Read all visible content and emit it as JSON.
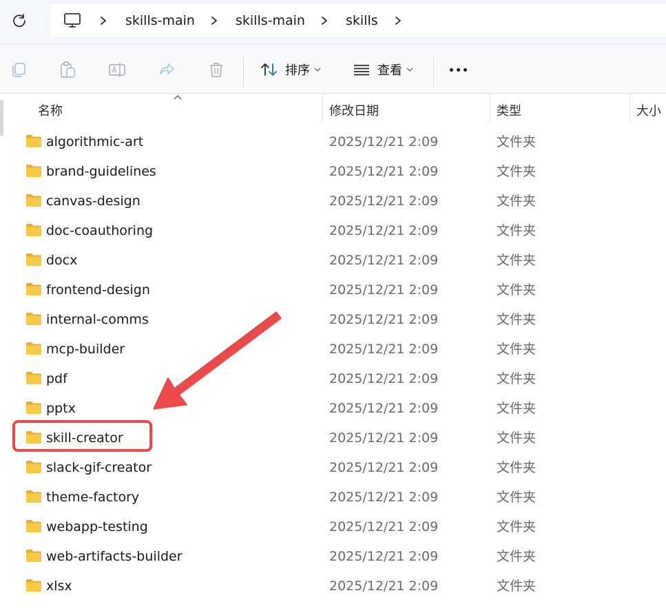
{
  "breadcrumb": [
    "skills-main",
    "skills-main",
    "skills"
  ],
  "toolbar": {
    "sort_label": "排序",
    "view_label": "查看"
  },
  "columns": {
    "name": "名称",
    "modified": "修改日期",
    "type": "类型",
    "size": "大小"
  },
  "files": [
    {
      "name": "algorithmic-art",
      "modified": "2025/12/21 2:09",
      "type": "文件夹"
    },
    {
      "name": "brand-guidelines",
      "modified": "2025/12/21 2:09",
      "type": "文件夹"
    },
    {
      "name": "canvas-design",
      "modified": "2025/12/21 2:09",
      "type": "文件夹"
    },
    {
      "name": "doc-coauthoring",
      "modified": "2025/12/21 2:09",
      "type": "文件夹"
    },
    {
      "name": "docx",
      "modified": "2025/12/21 2:09",
      "type": "文件夹"
    },
    {
      "name": "frontend-design",
      "modified": "2025/12/21 2:09",
      "type": "文件夹"
    },
    {
      "name": "internal-comms",
      "modified": "2025/12/21 2:09",
      "type": "文件夹"
    },
    {
      "name": "mcp-builder",
      "modified": "2025/12/21 2:09",
      "type": "文件夹"
    },
    {
      "name": "pdf",
      "modified": "2025/12/21 2:09",
      "type": "文件夹"
    },
    {
      "name": "pptx",
      "modified": "2025/12/21 2:09",
      "type": "文件夹"
    },
    {
      "name": "skill-creator",
      "modified": "2025/12/21 2:09",
      "type": "文件夹"
    },
    {
      "name": "slack-gif-creator",
      "modified": "2025/12/21 2:09",
      "type": "文件夹"
    },
    {
      "name": "theme-factory",
      "modified": "2025/12/21 2:09",
      "type": "文件夹"
    },
    {
      "name": "webapp-testing",
      "modified": "2025/12/21 2:09",
      "type": "文件夹"
    },
    {
      "name": "web-artifacts-builder",
      "modified": "2025/12/21 2:09",
      "type": "文件夹"
    },
    {
      "name": "xlsx",
      "modified": "2025/12/21 2:09",
      "type": "文件夹"
    }
  ],
  "colors": {
    "annotation": "#ea4a4a",
    "folder": "#f7c948",
    "accent": "#1f6fd1"
  },
  "icons": [
    "refresh-icon",
    "computer-icon",
    "copy-icon",
    "paste-icon",
    "rename-icon",
    "share-icon",
    "delete-icon",
    "sort-icon",
    "view-icon",
    "more-icon",
    "folder-icon"
  ]
}
